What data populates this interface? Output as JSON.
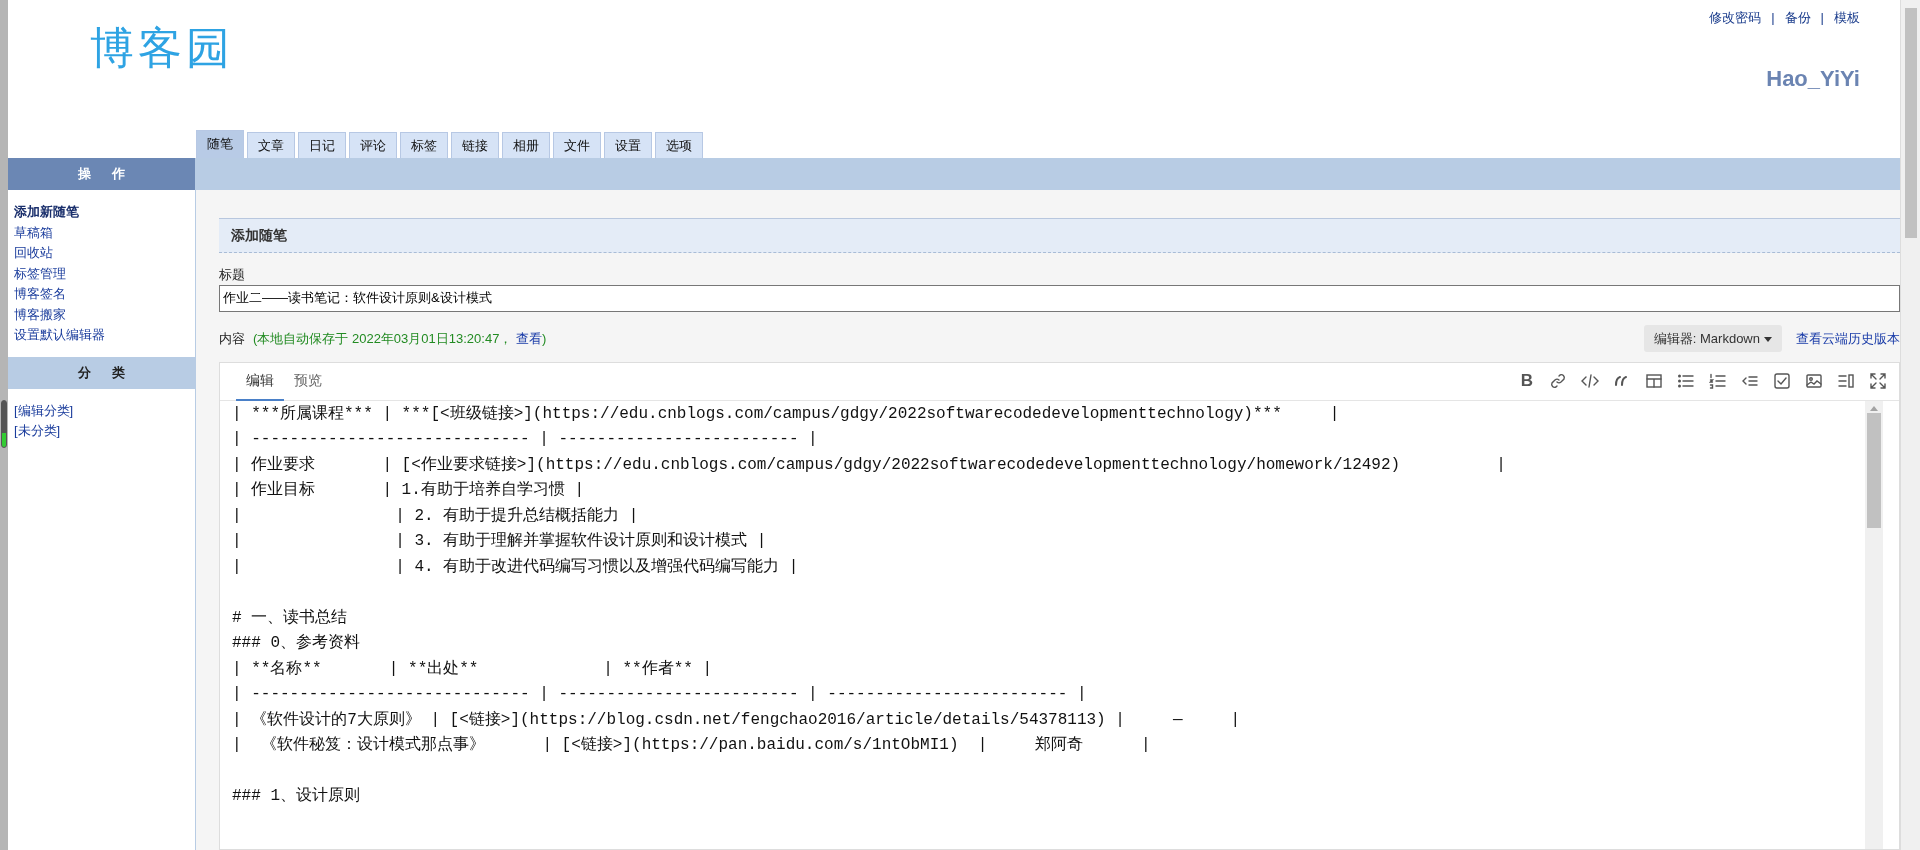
{
  "logo": {
    "text": "博客园"
  },
  "top_links": [
    "修改密码",
    "备份",
    "模板"
  ],
  "link_separators": [
    "|",
    "|"
  ],
  "user_name": "Hao_YiYi",
  "tabs": [
    {
      "label": "随笔",
      "selected": true
    },
    {
      "label": "文章",
      "selected": false
    },
    {
      "label": "日记",
      "selected": false
    },
    {
      "label": "评论",
      "selected": false
    },
    {
      "label": "标签",
      "selected": false
    },
    {
      "label": "链接",
      "selected": false
    },
    {
      "label": "相册",
      "selected": false
    },
    {
      "label": "文件",
      "selected": false
    },
    {
      "label": "设置",
      "selected": false
    },
    {
      "label": "选项",
      "selected": false
    }
  ],
  "sidebar": {
    "sections": [
      {
        "title": "操 作",
        "kind": "primary",
        "items": [
          {
            "label": "添加新随笔",
            "selected": true
          },
          {
            "label": "草稿箱",
            "selected": false
          },
          {
            "label": "回收站",
            "selected": false
          },
          {
            "label": "标签管理",
            "selected": false
          },
          {
            "label": "博客签名",
            "selected": false
          },
          {
            "label": "博客搬家",
            "selected": false
          },
          {
            "label": "设置默认编辑器",
            "selected": false
          }
        ]
      },
      {
        "title": "分 类",
        "kind": "secondary",
        "items": [
          {
            "label": "[编辑分类]",
            "selected": false
          },
          {
            "label": "[未分类]",
            "selected": false
          }
        ]
      }
    ]
  },
  "form": {
    "section_title": "添加随笔",
    "title_label": "标题",
    "title_value": "作业二——读书笔记：软件设计原则&设计模式",
    "content_label": "内容",
    "autosave_note": {
      "text": "(本地自动保存于 2022年03月01日13:20:47，",
      "link": "查看",
      "end": ")"
    },
    "editor_menu": "编辑器: Markdown",
    "history_link": "查看云端历史版本"
  },
  "editor": {
    "tabs": [
      {
        "label": "编辑",
        "selected": true
      },
      {
        "label": "预览",
        "selected": false
      }
    ],
    "toolbar": [
      {
        "kind": "bold",
        "label": "B"
      },
      {
        "kind": "link"
      },
      {
        "kind": "code"
      },
      {
        "kind": "quote"
      },
      {
        "kind": "table"
      },
      {
        "kind": "bullet-list"
      },
      {
        "kind": "numbered-list"
      },
      {
        "kind": "outdent"
      },
      {
        "kind": "checkbox"
      },
      {
        "kind": "image"
      },
      {
        "kind": "preview"
      },
      {
        "kind": "fullscreen"
      }
    ],
    "blocks": [
      [
        "| ***所属课程*** | ***[<班级链接>](https://edu.cnblogs.com/campus/gdgy/2022softwarecodedevelopmenttechnology)***     |",
        "| ----------------------------- | ------------------------- |",
        "| 作业要求       | [<作业要求链接>](https://edu.cnblogs.com/campus/gdgy/2022softwarecodedevelopmenttechnology/homework/12492)          |",
        "| 作业目标       | 1.有助于培养自学习惯 |",
        "|                | 2. 有助于提升总结概括能力 |",
        "|                | 3. 有助于理解并掌握软件设计原则和设计模式 |",
        "|                | 4. 有助于改进代码编写习惯以及增强代码编写能力 |"
      ],
      [
        "# 一、读书总结",
        "### 0、参考资料",
        "| **名称**       | **出处**             | **作者** |",
        "| ----------------------------- | ------------------------- | ------------------------- |",
        "| 《软件设计的7大原则》 | [<链接>](https://blog.csdn.net/fengchao2016/article/details/54378113) |     —     |",
        "|  《软件秘笈：设计模式那点事》      | [<链接>](https://pan.baidu.com/s/1ntObMI1)  |     郑阿奇      |"
      ],
      [
        "### 1、设计原则"
      ]
    ]
  }
}
